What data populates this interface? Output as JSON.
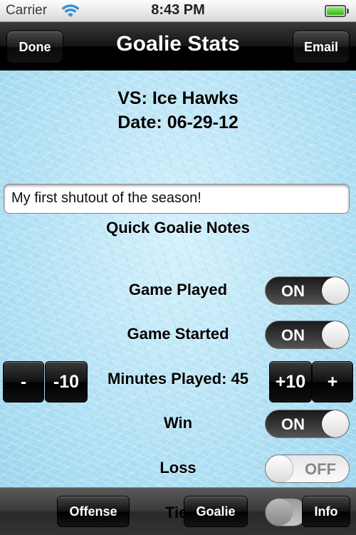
{
  "status_bar": {
    "carrier": "Carrier",
    "time": "8:43 PM",
    "battery_level": 1.0
  },
  "nav_bar": {
    "title": "Goalie Stats",
    "left_button": "Done",
    "right_button": "Email"
  },
  "game": {
    "opponent": "VS: Ice Hawks",
    "date": "Date: 06-29-12"
  },
  "notes": {
    "value": "My first shutout of the season!",
    "label": "Quick Goalie Notes"
  },
  "rows": [
    {
      "label": "Game Played",
      "state": "ON",
      "on": true
    },
    {
      "label": "Game Started",
      "state": "ON",
      "on": true
    },
    {
      "label": "Win",
      "state": "ON",
      "on": true
    },
    {
      "label": "Loss",
      "state": "OFF",
      "on": false
    }
  ],
  "minutes": {
    "label": "Minutes Played: 45",
    "minus_one": "-",
    "minus_ten": "-10",
    "plus_ten": "+10",
    "plus_one": "+"
  },
  "tab_bar": {
    "offense": "Offense",
    "goalie": "Goalie",
    "info": "Info",
    "tie_label_peek": "Tie"
  },
  "colors": {
    "ice": "#b4e2f5",
    "nav_bar": "#000000",
    "battery": "#36b31c"
  }
}
